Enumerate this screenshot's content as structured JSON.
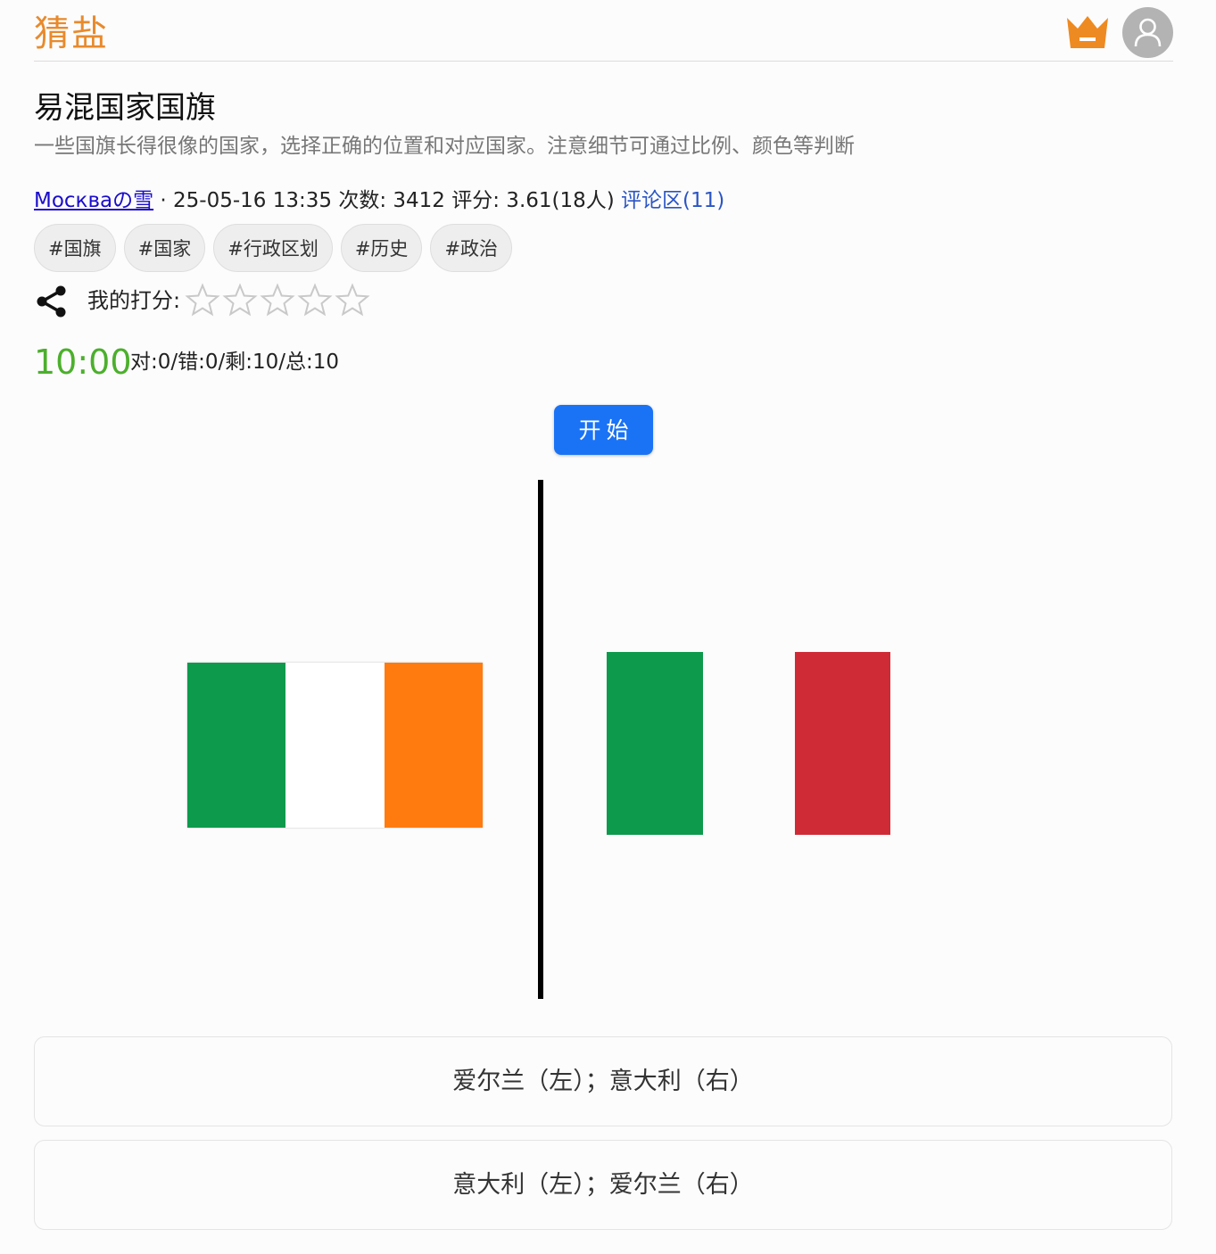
{
  "header": {
    "logo": "猜盐"
  },
  "quiz": {
    "title": "易混国家国旗",
    "description": "一些国旗长得很像的国家，选择正确的位置和对应国家。注意细节可通过比例、颜色等判断",
    "author": "Москваの雪",
    "meta_text": " · 25-05-16 13:35 次数: 3412 评分: 3.61(18人) ",
    "comments": "评论区(11)",
    "tags": [
      "#国旗",
      "#国家",
      "#行政区划",
      "#历史",
      "#政治"
    ],
    "rating_label": "我的打分:",
    "rating_max": 5,
    "timer": "10:00",
    "score": "对:0/错:0/剩:10/总:10",
    "start_label": "开始"
  },
  "colors": {
    "accent": "#e88a2c",
    "timer": "#4caf2d",
    "button": "#1a73f5",
    "flag_green": "#0d9a4c",
    "flag_white": "#ffffff",
    "flag_orange": "#ff7b0f",
    "flag_red": "#cf2b37"
  },
  "options": [
    {
      "label": "爱尔兰（左）；意大利（右）"
    },
    {
      "label": "意大利（左）；爱尔兰（右）"
    }
  ]
}
